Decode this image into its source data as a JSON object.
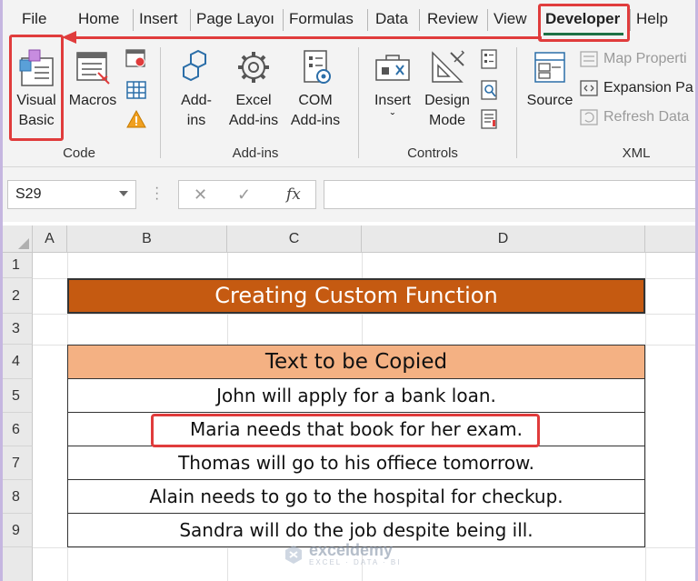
{
  "menu": {
    "tabs": [
      {
        "label": "File"
      },
      {
        "label": "Home"
      },
      {
        "label": "Insert"
      },
      {
        "label": "Page Layoı"
      },
      {
        "label": "Formulas"
      },
      {
        "label": "Data"
      },
      {
        "label": "Review"
      },
      {
        "label": "View"
      },
      {
        "label": "Developer"
      },
      {
        "label": "Help"
      }
    ],
    "active_tab": "Developer"
  },
  "ribbon": {
    "code": {
      "label": "Code",
      "visual_basic_line1": "Visual",
      "visual_basic_line2": "Basic",
      "macros": "Macros"
    },
    "addins": {
      "label": "Add-ins",
      "addins_line1": "Add-",
      "addins_line2": "ins",
      "excel_line1": "Excel",
      "excel_line2": "Add-ins",
      "com_line1": "COM",
      "com_line2": "Add-ins"
    },
    "controls": {
      "label": "Controls",
      "insert": "Insert",
      "insert_caret": "ˇ",
      "design_line1": "Design",
      "design_line2": "Mode"
    },
    "xml": {
      "label": "XML",
      "source": "Source",
      "map_properties": "Map Properti",
      "expansion_packs": "Expansion Pa",
      "refresh_data": "Refresh Data"
    }
  },
  "formula_bar": {
    "name_box": "S29",
    "cancel": "✕",
    "enter": "✓",
    "fx": "fx",
    "formula": ""
  },
  "sheet": {
    "columns": [
      "A",
      "B",
      "C",
      "D"
    ],
    "rows": [
      "1",
      "2",
      "3",
      "4",
      "5",
      "6",
      "7",
      "8",
      "9"
    ],
    "title": "Creating Custom Function",
    "table_header": "Text to be Copied",
    "table_rows": [
      "John will apply for a bank loan.",
      "Maria needs that book for her exam.",
      "Thomas will go to his offiece tomorrow.",
      "Alain needs to go to the hospital for checkup.",
      "Sandra will do the job despite being ill."
    ],
    "highlighted_row": 1
  },
  "watermark": {
    "name": "exceldemy",
    "tagline": "EXCEL · DATA · BI"
  },
  "colors": {
    "title_fill": "#c55a11",
    "header_fill": "#f4b183",
    "highlight": "#e03c3c",
    "developer_underline": "#1e7145"
  }
}
